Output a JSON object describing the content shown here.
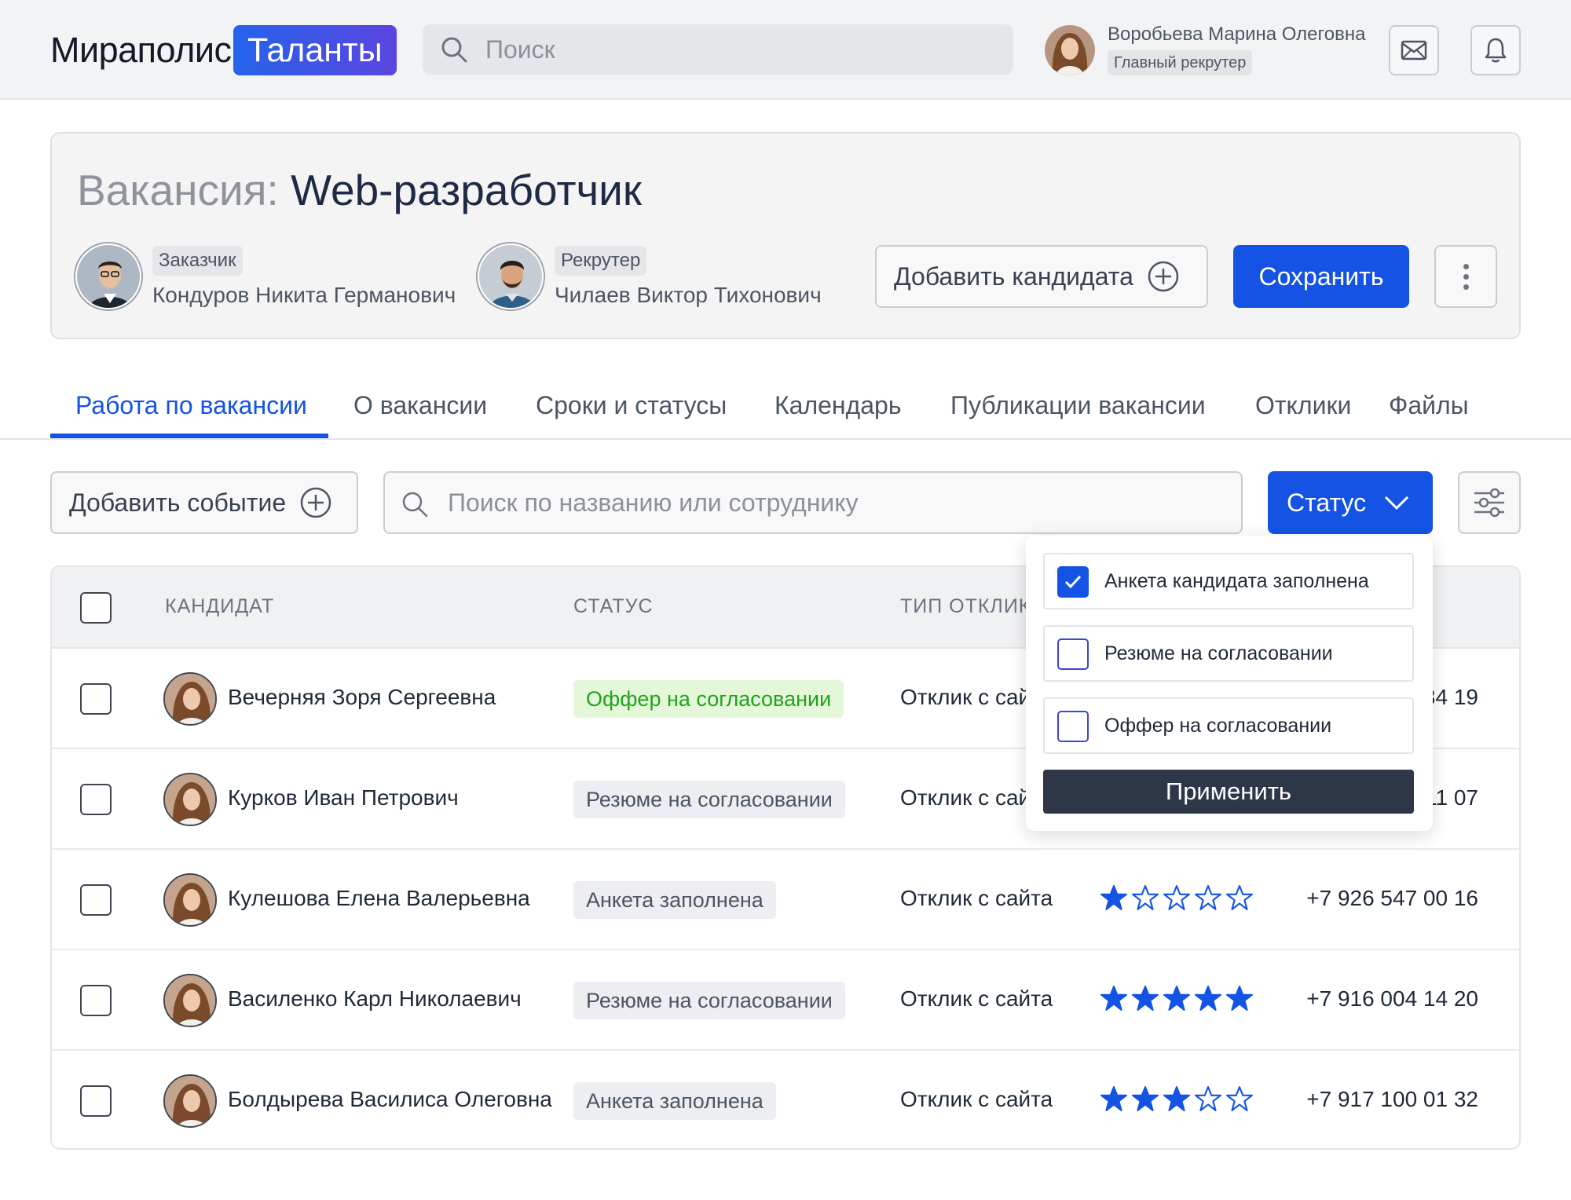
{
  "header": {
    "logo_text": "Мираполис",
    "logo_badge": "Таланты",
    "search_placeholder": "Поиск",
    "user": {
      "name": "Воробьева Марина Олеговна",
      "role": "Главный рекрутер"
    },
    "icons": [
      "search-icon",
      "mail-icon",
      "bell-icon"
    ]
  },
  "vacancy": {
    "title_prefix": "Вакансия:",
    "title": "Web-разработчик",
    "customer": {
      "role": "Заказчик",
      "name": "Кондуров Никита Германович"
    },
    "recruiter": {
      "role": "Рекрутер",
      "name": "Чилаев Виктор Тихонович"
    },
    "add_candidate_label": "Добавить кандидата",
    "save_label": "Сохранить"
  },
  "tabs": [
    {
      "label": "Работа по вакансии",
      "active": true
    },
    {
      "label": "О вакансии",
      "active": false
    },
    {
      "label": "Сроки и статусы",
      "active": false
    },
    {
      "label": "Календарь",
      "active": false
    },
    {
      "label": "Публикации вакансии",
      "active": false
    },
    {
      "label": "Отклики",
      "active": false
    },
    {
      "label": "Файлы",
      "active": false
    }
  ],
  "toolbar": {
    "add_event_label": "Добавить событие",
    "search_placeholder": "Поиск по названию или сотруднику",
    "status_label": "Статус"
  },
  "table": {
    "columns": [
      "КАНДИДАТ",
      "СТАТУС",
      "ТИП ОТКЛИКА"
    ],
    "rows": [
      {
        "name": "Вечерняя Зоря Сергеевна",
        "status": "Оффер на согласовании",
        "status_kind": "offer",
        "response": "Отклик с сайта",
        "rating": 0,
        "phone": "+7 916 000 34 19"
      },
      {
        "name": "Курков Иван Петрович",
        "status": "Резюме на согласовании",
        "status_kind": "neutral",
        "response": "Отклик с сайта",
        "rating": 0,
        "phone": "+7 916 000 11 07"
      },
      {
        "name": "Кулешова Елена Валерьевна",
        "status": "Анкета заполнена",
        "status_kind": "neutral",
        "response": "Отклик с сайта",
        "rating": 1,
        "phone": "+7 926 547 00 16"
      },
      {
        "name": "Василенко Карл Николаевич",
        "status": "Резюме на согласовании",
        "status_kind": "neutral",
        "response": "Отклик с сайта",
        "rating": 5,
        "phone": "+7 916 004 14 20"
      },
      {
        "name": "Болдырева Василиса Олеговна",
        "status": "Анкета заполнена",
        "status_kind": "neutral",
        "response": "Отклик с сайта",
        "rating": 3,
        "phone": "+7 917 100 01 32"
      }
    ]
  },
  "status_dropdown": {
    "options": [
      {
        "label": "Анкета кандидата заполнена",
        "checked": true
      },
      {
        "label": "Резюме на согласовании",
        "checked": false
      },
      {
        "label": "Оффер на согласовании",
        "checked": false
      }
    ],
    "apply_label": "Применить"
  },
  "colors": {
    "accent": "#1453e4",
    "offer_bg": "#e4f8d9",
    "offer_text": "#21a31c",
    "dark_button": "#2d3748",
    "star": "#1453e4"
  }
}
